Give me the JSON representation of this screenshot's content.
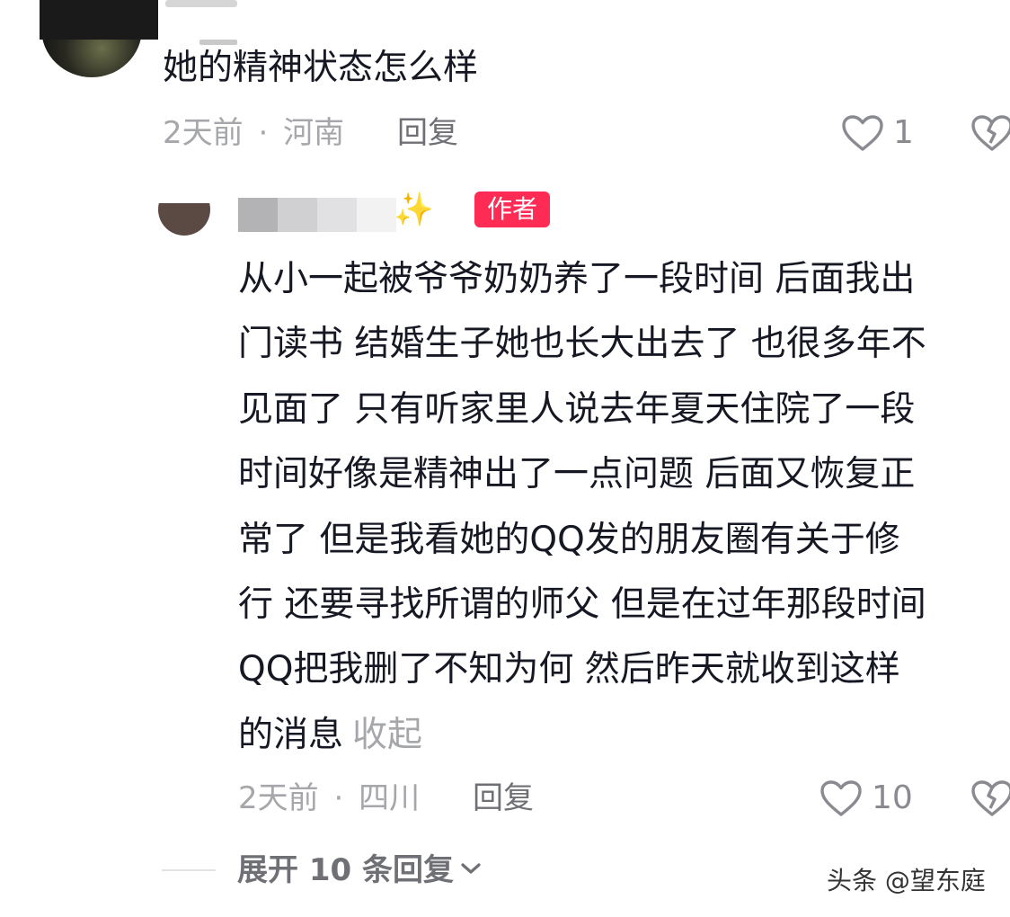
{
  "top_comment": {
    "content": "她的精神状态怎么样",
    "time": "2天前",
    "location": "河南",
    "separator": "·",
    "reply_label": "回复",
    "like_count": "1"
  },
  "reply_comment": {
    "sparkle": "✨",
    "author_badge": "作者",
    "lines": [
      "从小一起被爷爷奶奶养了一段时间 后面我出",
      "门读书 结婚生子她也长大出去了 也很多年不",
      "见面了 只有听家里人说去年夏天住院了一段",
      "时间好像是精神出了一点问题 后面又恢复正",
      "常了 但是我看她的QQ发的朋友圈有关于修",
      "行 还要寻找所谓的师父 但是在过年那段时间",
      "QQ把我删了不知为何 然后昨天就收到这样",
      "的消息"
    ],
    "collapse_label": "收起",
    "time": "2天前",
    "location": "四川",
    "separator": "·",
    "reply_label": "回复",
    "like_count": "10"
  },
  "expand_replies": {
    "label": "展开 10 条回复"
  },
  "watermark": "头条 @望东庭",
  "icons": {
    "like": "heart-outline-icon",
    "dislike": "broken-heart-icon",
    "expand": "chevron-down-icon"
  },
  "colors": {
    "author_badge": "#fe2c55",
    "meta_text": "#a6a7ab",
    "body_text": "#161823"
  }
}
